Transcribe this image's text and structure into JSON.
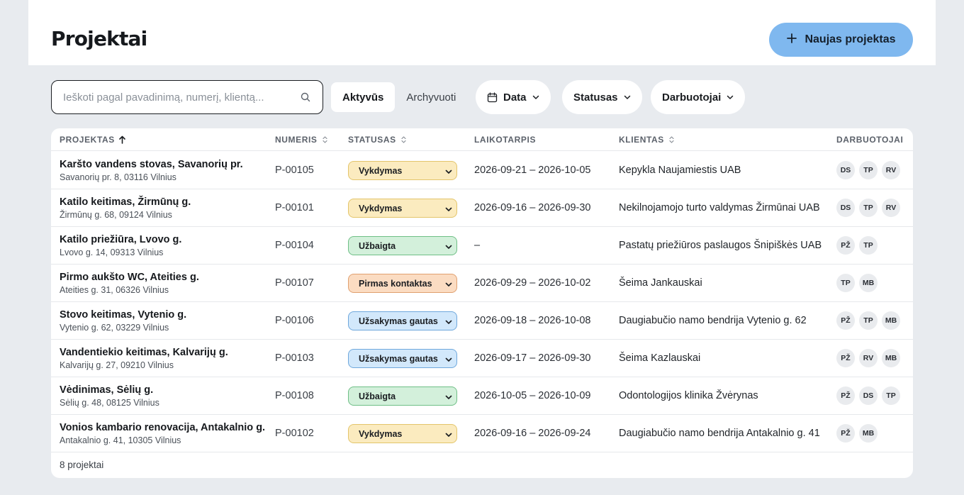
{
  "header": {
    "title": "Projektai",
    "new_button_label": "Naujas projektas",
    "new_button_icon": "plus-icon"
  },
  "toolbar": {
    "search_placeholder": "Ieškoti pagal pavadinimą, numerį, klientą...",
    "search_value": "",
    "segments": [
      "Aktyvūs",
      "Archyvuoti"
    ],
    "active_segment": "Aktyvūs",
    "filters": {
      "date": "Data",
      "status": "Statusas",
      "employees": "Darbuotojai"
    }
  },
  "colors": {
    "accent": "#7fb8ef",
    "status_vykdymas": "#fbebbf",
    "status_uzbaigta": "#d3f0db",
    "status_pirmas_kontaktas": "#fbdcc2",
    "status_uzsakymas_gautas": "#d2e8fb"
  },
  "table": {
    "columns": {
      "project": "PROJEKTAS",
      "number": "NUMERIS",
      "status": "STATUSAS",
      "period": "LAIKOTARPIS",
      "client": "KLIENTAS",
      "employees": "DARBUOTOJAI"
    },
    "rows": [
      {
        "name": "Karšto vandens stovas, Savanorių pr.",
        "address": "Savanorių pr. 8, 03116 Vilnius",
        "number": "P-00105",
        "status": "Vykdymas",
        "status_key": "vykdymas",
        "period": "2026-09-21 – 2026-10-05",
        "client": "Kepykla Naujamiestis UAB",
        "employees": [
          "DS",
          "TP",
          "RV"
        ]
      },
      {
        "name": "Katilo keitimas, Žirmūnų g.",
        "address": "Žirmūnų g. 68, 09124 Vilnius",
        "number": "P-00101",
        "status": "Vykdymas",
        "status_key": "vykdymas",
        "period": "2026-09-16 – 2026-09-30",
        "client": "Nekilnojamojo turto valdymas Žirmūnai UAB",
        "employees": [
          "DS",
          "TP",
          "RV"
        ]
      },
      {
        "name": "Katilo priežiūra, Lvovo g.",
        "address": "Lvovo g. 14, 09313 Vilnius",
        "number": "P-00104",
        "status": "Užbaigta",
        "status_key": "uzbaigta",
        "period": "–",
        "client": "Pastatų priežiūros paslaugos Šnipiškės UAB",
        "employees": [
          "PŽ",
          "TP"
        ]
      },
      {
        "name": "Pirmo aukšto WC, Ateities g.",
        "address": "Ateities g. 31, 06326 Vilnius",
        "number": "P-00107",
        "status": "Pirmas kontaktas",
        "status_key": "pirmas_kontaktas",
        "period": "2026-09-29 – 2026-10-02",
        "client": "Šeima Jankauskai",
        "employees": [
          "TP",
          "MB"
        ]
      },
      {
        "name": "Stovo keitimas, Vytenio g.",
        "address": "Vytenio g. 62, 03229 Vilnius",
        "number": "P-00106",
        "status": "Užsakymas gautas",
        "status_key": "uzsakymas_gautas",
        "period": "2026-09-18 – 2026-10-08",
        "client": "Daugiabučio namo bendrija Vytenio g. 62",
        "employees": [
          "PŽ",
          "TP",
          "MB"
        ]
      },
      {
        "name": "Vandentiekio keitimas, Kalvarijų g.",
        "address": "Kalvarijų g. 27, 09210 Vilnius",
        "number": "P-00103",
        "status": "Užsakymas gautas",
        "status_key": "uzsakymas_gautas",
        "period": "2026-09-17 – 2026-09-30",
        "client": "Šeima Kazlauskai",
        "employees": [
          "PŽ",
          "RV",
          "MB"
        ]
      },
      {
        "name": "Vėdinimas, Sėlių g.",
        "address": "Sėlių g. 48, 08125 Vilnius",
        "number": "P-00108",
        "status": "Užbaigta",
        "status_key": "uzbaigta",
        "period": "2026-10-05 – 2026-10-09",
        "client": "Odontologijos klinika Žvėrynas",
        "employees": [
          "PŽ",
          "DS",
          "TP"
        ]
      },
      {
        "name": "Vonios kambario renovacija, Antakalnio g.",
        "address": "Antakalnio g. 41, 10305 Vilnius",
        "number": "P-00102",
        "status": "Vykdymas",
        "status_key": "vykdymas",
        "period": "2026-09-16 – 2026-09-24",
        "client": "Daugiabučio namo bendrija Antakalnio g. 41",
        "employees": [
          "PŽ",
          "MB"
        ]
      }
    ],
    "footer_count": "8 projektai"
  }
}
